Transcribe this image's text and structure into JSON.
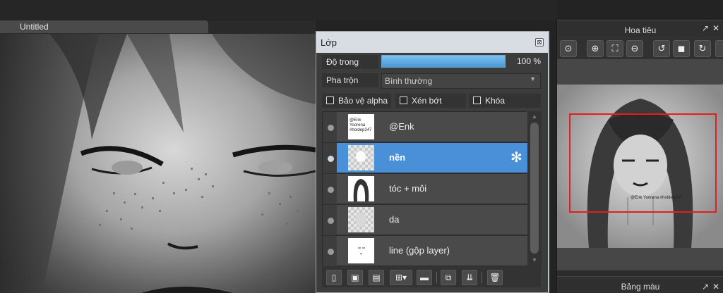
{
  "document": {
    "tab_title": "Untitled"
  },
  "layers_panel": {
    "title": "Lớp",
    "close_glyph": "⊠",
    "opacity": {
      "label": "Độ trong",
      "value": 100,
      "value_text": "100 %"
    },
    "blend": {
      "label": "Pha trộn",
      "selected": "Bình thường"
    },
    "checkboxes": [
      {
        "label": "Bảo vệ alpha",
        "checked": false
      },
      {
        "label": "Xén bớt",
        "checked": false
      },
      {
        "label": "Khóa",
        "checked": false
      }
    ],
    "layers": [
      {
        "name": "@Enk",
        "selected": false,
        "visible": true
      },
      {
        "name": "nền",
        "selected": true,
        "visible": true
      },
      {
        "name": "tóc + môi",
        "selected": false,
        "visible": true
      },
      {
        "name": "da",
        "selected": false,
        "visible": true
      },
      {
        "name": "line (gộp layer)",
        "selected": false,
        "visible": true
      }
    ],
    "thumb_caption": "@Enk Yoorena #holdep247",
    "toolbar_icons": [
      "new-layer-icon",
      "new-layer-8bit-icon",
      "new-layer-1bit-icon",
      "add-layer-menu-icon",
      "new-folder-icon",
      "duplicate-layer-icon",
      "merge-down-icon",
      "delete-layer-icon"
    ]
  },
  "navigator": {
    "title": "Hoa tiêu",
    "tools": [
      "zoom-actual-icon",
      "zoom-in-icon",
      "fit-icon",
      "zoom-out-icon",
      "rotate-left-icon",
      "reset-view-icon",
      "rotate-right-icon"
    ],
    "thumb_caption": "@Enk Yoorena #holdep247"
  },
  "palette": {
    "title": "Bảng màu"
  },
  "colors": {
    "selected_layer": "#4a90d9",
    "accent_red": "#e02020"
  }
}
